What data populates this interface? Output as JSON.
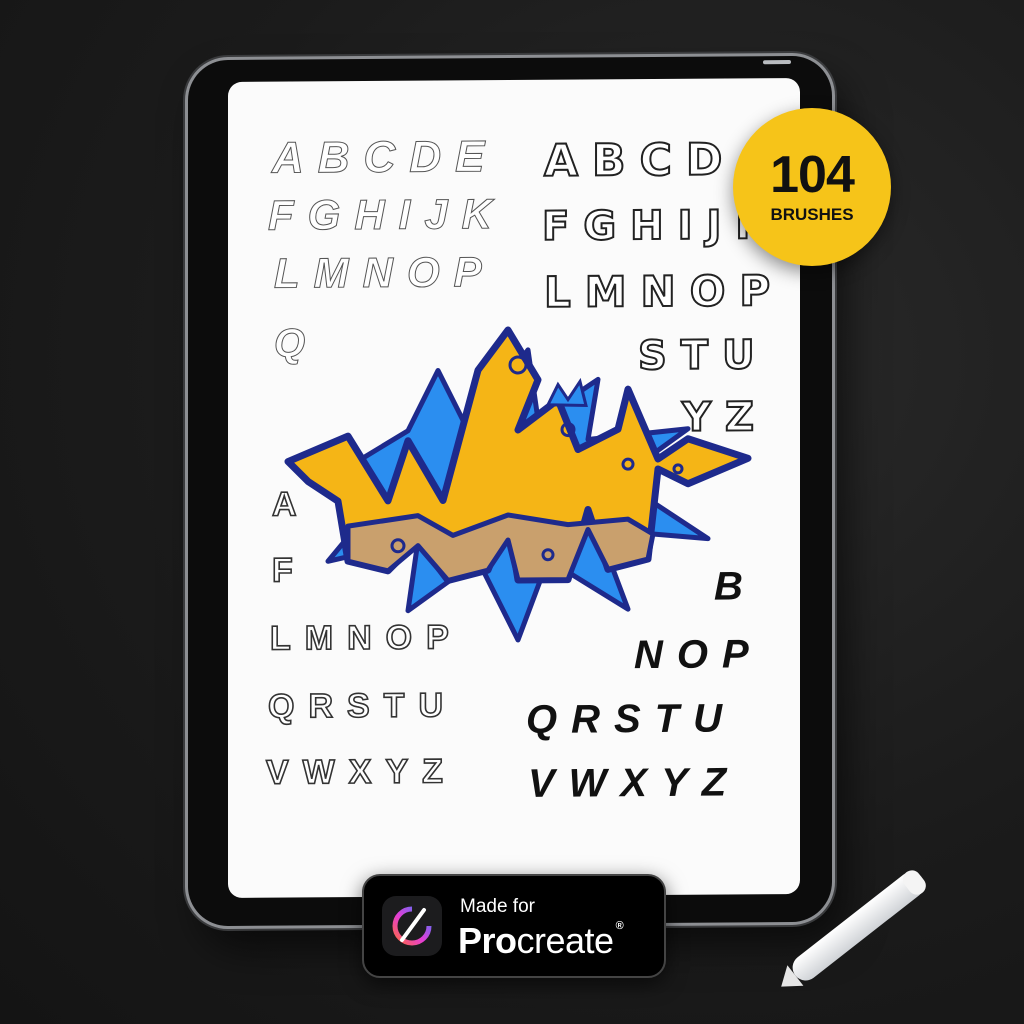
{
  "badge": {
    "count": "104",
    "label": "BRUSHES"
  },
  "procreate": {
    "made_for": "Made for",
    "brand_bold": "Pro",
    "brand_light": "create",
    "registered": "®"
  },
  "alphabets": {
    "thin_row1": "ABCDE",
    "thin_row2": "FGHIJK",
    "thin_row3": "LMNOP",
    "thin_row4": "Q",
    "bubble_row1": "ABCD",
    "bubble_row2": "FGHIJK",
    "bubble_row3": "LMNOP",
    "bubble_row4": "STU",
    "bubble_row5": "YZ",
    "outline_row1": "A",
    "outline_row2": "F",
    "outline_row3": "LMNOP",
    "outline_row4": "QRSTU",
    "outline_row5": "VWXYZ",
    "ink_row1": "B",
    "ink_row2": "NOP",
    "ink_row3": "QRSTU",
    "ink_row4": "VWXYZ"
  },
  "colors": {
    "badge": "#f6c419",
    "graffiti_fill": "#f5b516",
    "graffiti_outline": "#1e2a8c",
    "graffiti_burst": "#2b8ef0",
    "graffiti_tan": "#c9a06d"
  }
}
